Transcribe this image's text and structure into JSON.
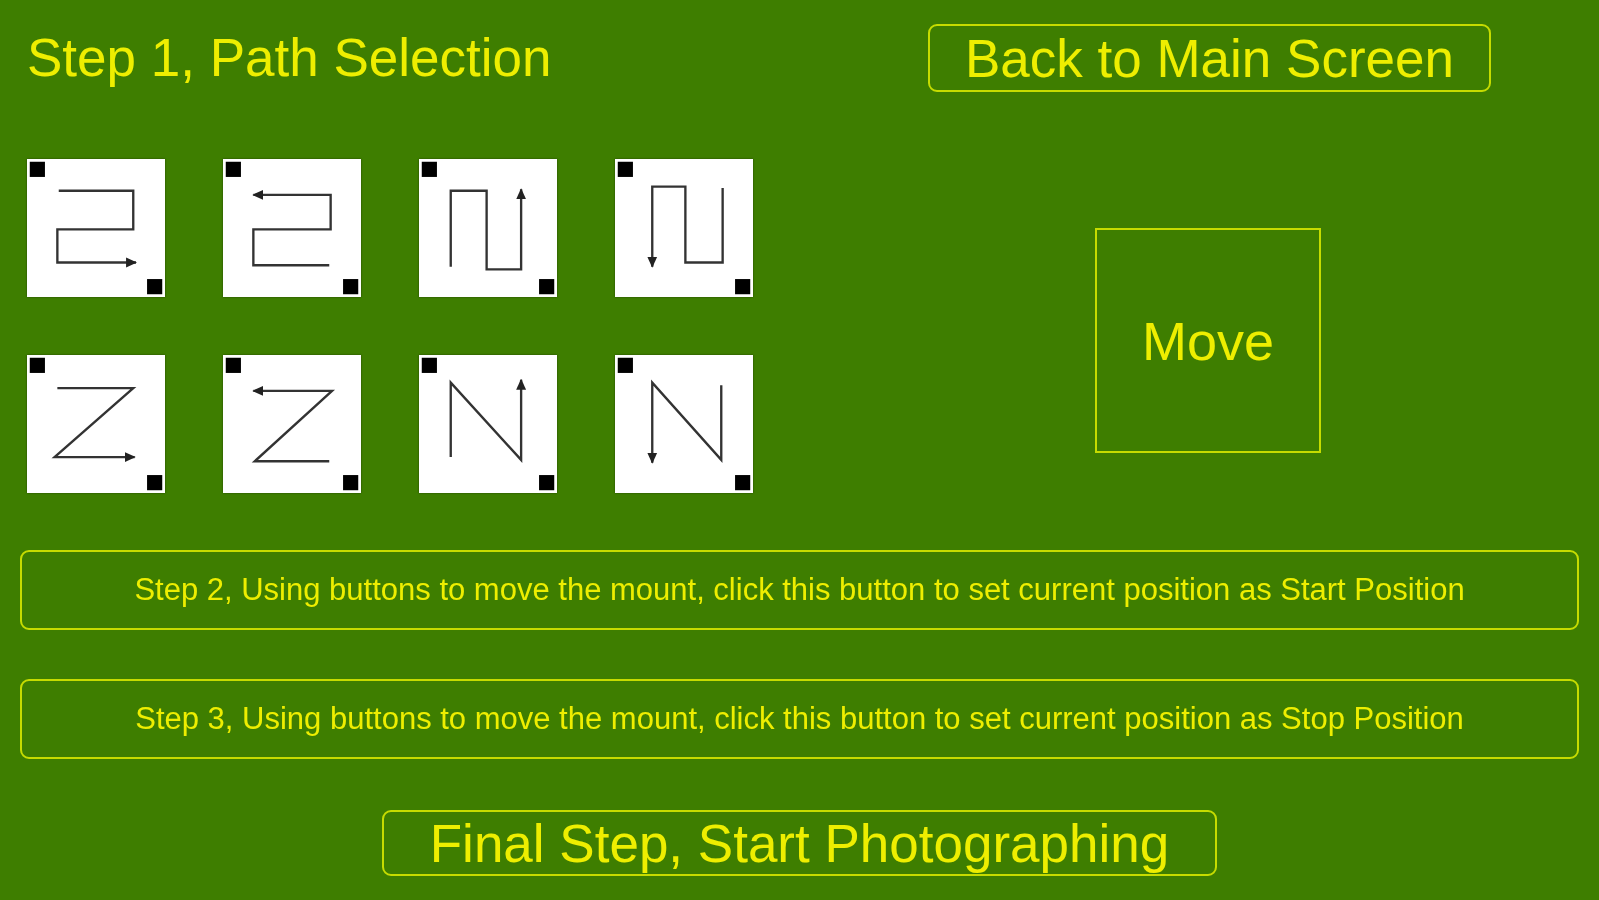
{
  "title": "Step 1, Path Selection",
  "back_button": "Back to Main Screen",
  "path_options": [
    {
      "kind": "snake-right"
    },
    {
      "kind": "snake-left"
    },
    {
      "kind": "snake-up"
    },
    {
      "kind": "snake-down"
    },
    {
      "kind": "zigzag-right"
    },
    {
      "kind": "zigzag-left"
    },
    {
      "kind": "zigzag-up"
    },
    {
      "kind": "zigzag-down"
    }
  ],
  "move_button": "Move",
  "step_buttons": [
    "Step 2, Using buttons to move the mount, click this button to set current position as Start Position",
    "Step 3, Using buttons to move the mount, click this button to set current position as Stop Position"
  ],
  "final_button": "Final Step, Start Photographing"
}
